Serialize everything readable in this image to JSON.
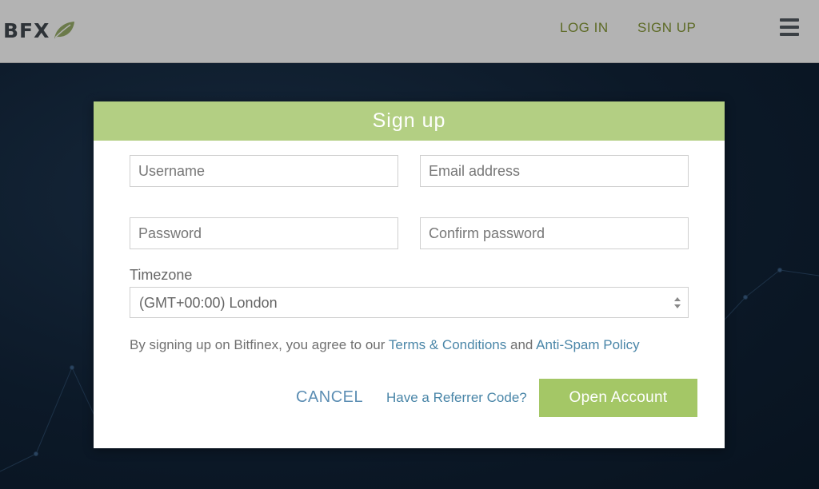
{
  "header": {
    "logo_text": "BFX",
    "login_label": "LOG IN",
    "signup_label": "SIGN UP"
  },
  "modal": {
    "title": "Sign up",
    "username_placeholder": "Username",
    "email_placeholder": "Email address",
    "password_placeholder": "Password",
    "confirm_placeholder": "Confirm password",
    "timezone_label": "Timezone",
    "timezone_value": "(GMT+00:00) London",
    "agree_prefix": "By signing up on Bitfinex, you agree to our",
    "terms_link": "Terms & Conditions",
    "agree_and": "and",
    "antispam_link": "Anti-Spam Policy",
    "cancel_label": "CANCEL",
    "referrer_label": "Have a Referrer Code?",
    "open_account_label": "Open Account"
  },
  "colors": {
    "header_green": "#b3cf83",
    "button_green": "#a4c766",
    "link_blue": "#4a86a8",
    "nav_olive": "#5d6a25"
  },
  "icons": [
    "leaf-icon",
    "hamburger-menu-icon",
    "select-arrows-icon"
  ]
}
